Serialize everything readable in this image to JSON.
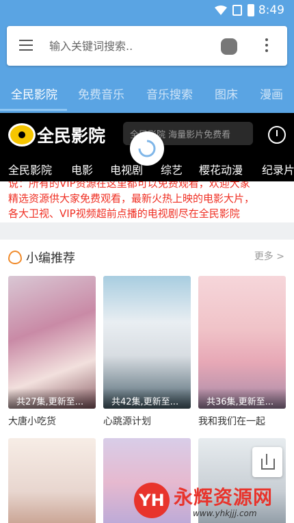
{
  "status_bar": {
    "time": "8:49"
  },
  "search": {
    "placeholder": "输入关键词搜索.."
  },
  "tabs": [
    "全民影院",
    "免费音乐",
    "音乐搜索",
    "图床",
    "漫画"
  ],
  "site": {
    "logo_text": "全民影院",
    "search_placeholder": "全民影院 海量影片免费看",
    "categories": [
      "全民影院",
      "电影",
      "电视剧",
      "综艺",
      "樱花动漫",
      "纪录片"
    ]
  },
  "notice": {
    "line1": "说：所有的VIP资源在这里都可以免费观看，欢迎大家",
    "line2": "精选资源供大家免费观看，最新火热上映的电影大片，",
    "line3": "各大卫视、VIP视频超前点播的电视剧尽在全民影院"
  },
  "recommend": {
    "title": "小编推荐",
    "more": "更多 >",
    "items": [
      {
        "title": "大唐小吃货",
        "episodes": "共27集,更新至..."
      },
      {
        "title": "心跳源计划",
        "episodes": "共42集,更新至..."
      },
      {
        "title": "我和我们在一起",
        "episodes": "共36集,更新至..."
      }
    ]
  },
  "watermark": {
    "brand": "永辉资源网",
    "url": "www.yhkjjj.com",
    "logo": "YH"
  },
  "colors": {
    "app_bar": "#5aa4e3",
    "notice_red": "#ef2e22",
    "site_bg": "#000000"
  }
}
